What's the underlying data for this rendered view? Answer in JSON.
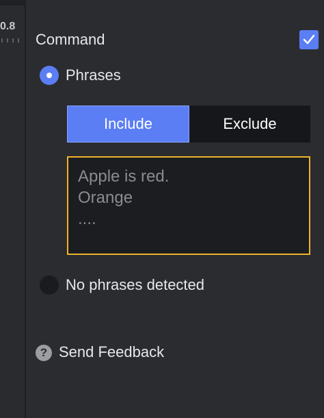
{
  "left_panel": {
    "value_label": "0.8"
  },
  "command": {
    "label": "Command",
    "checked": true
  },
  "phrases_option": {
    "label": "Phrases",
    "selected": true
  },
  "mode_toggle": {
    "include_label": "Include",
    "exclude_label": "Exclude",
    "active": "Include"
  },
  "phrases_input": {
    "placeholder_lines": [
      "Apple is red.",
      "Orange",
      "...."
    ]
  },
  "no_phrases_option": {
    "label": "No phrases detected",
    "selected": false
  },
  "feedback": {
    "label": "Send Feedback",
    "icon": "help-icon"
  },
  "colors": {
    "accent": "#5b7ef5",
    "focus_border": "#f0b429",
    "background": "#2b2c30"
  }
}
